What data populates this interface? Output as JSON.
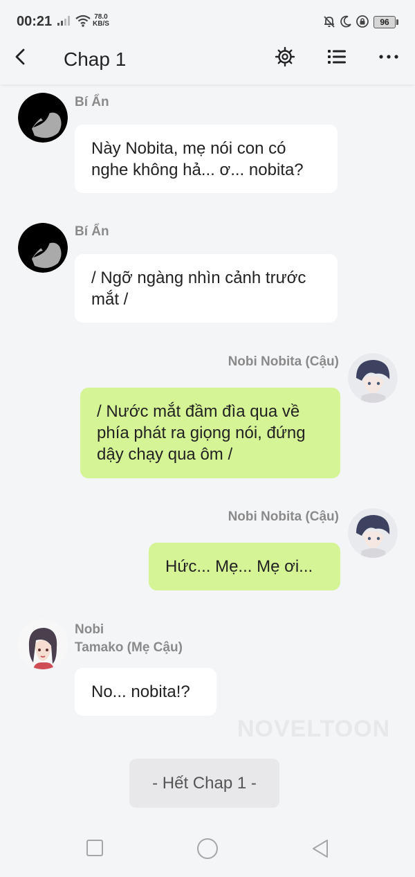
{
  "status_bar": {
    "time": "00:21",
    "speed_value": "78.0",
    "speed_unit": "KB/S",
    "battery": "96",
    "icons": [
      "signal-icon",
      "wifi-icon",
      "bell-muted-icon",
      "moon-icon",
      "lock-rotation-icon",
      "battery-icon"
    ]
  },
  "header": {
    "title": "Chap 1",
    "actions": [
      "gear-icon",
      "list-icon",
      "more-icon"
    ]
  },
  "messages": [
    {
      "side": "left",
      "sender": "Bí Ẩn",
      "text": "Này Nobita, mẹ nói con có nghe không hả... ơ... nobita?"
    },
    {
      "side": "left",
      "sender": "Bí Ẩn",
      "text": "/ Ngỡ ngàng nhìn cảnh trước mắt /"
    },
    {
      "side": "right",
      "sender": "Nobi Nobita (Cậu)",
      "text": "/ Nước mắt đầm đìa qua về phía phát ra giọng nói, đứng dậy chạy qua ôm /"
    },
    {
      "side": "right",
      "sender": "Nobi Nobita (Cậu)",
      "text": "Hức... Mẹ... Mẹ ơi..."
    },
    {
      "side": "left",
      "sender_line1": "Nobi",
      "sender_line2": "Tamako (Mẹ Cậu)",
      "text": "No... nobita!?"
    }
  ],
  "watermark": "NOVELTOON",
  "end_button": "- Hết Chap 1 -",
  "colors": {
    "background": "#f4f5f7",
    "bubble_left": "#ffffff",
    "bubble_right": "#d4f496",
    "sender_text": "#8a8a8a"
  }
}
